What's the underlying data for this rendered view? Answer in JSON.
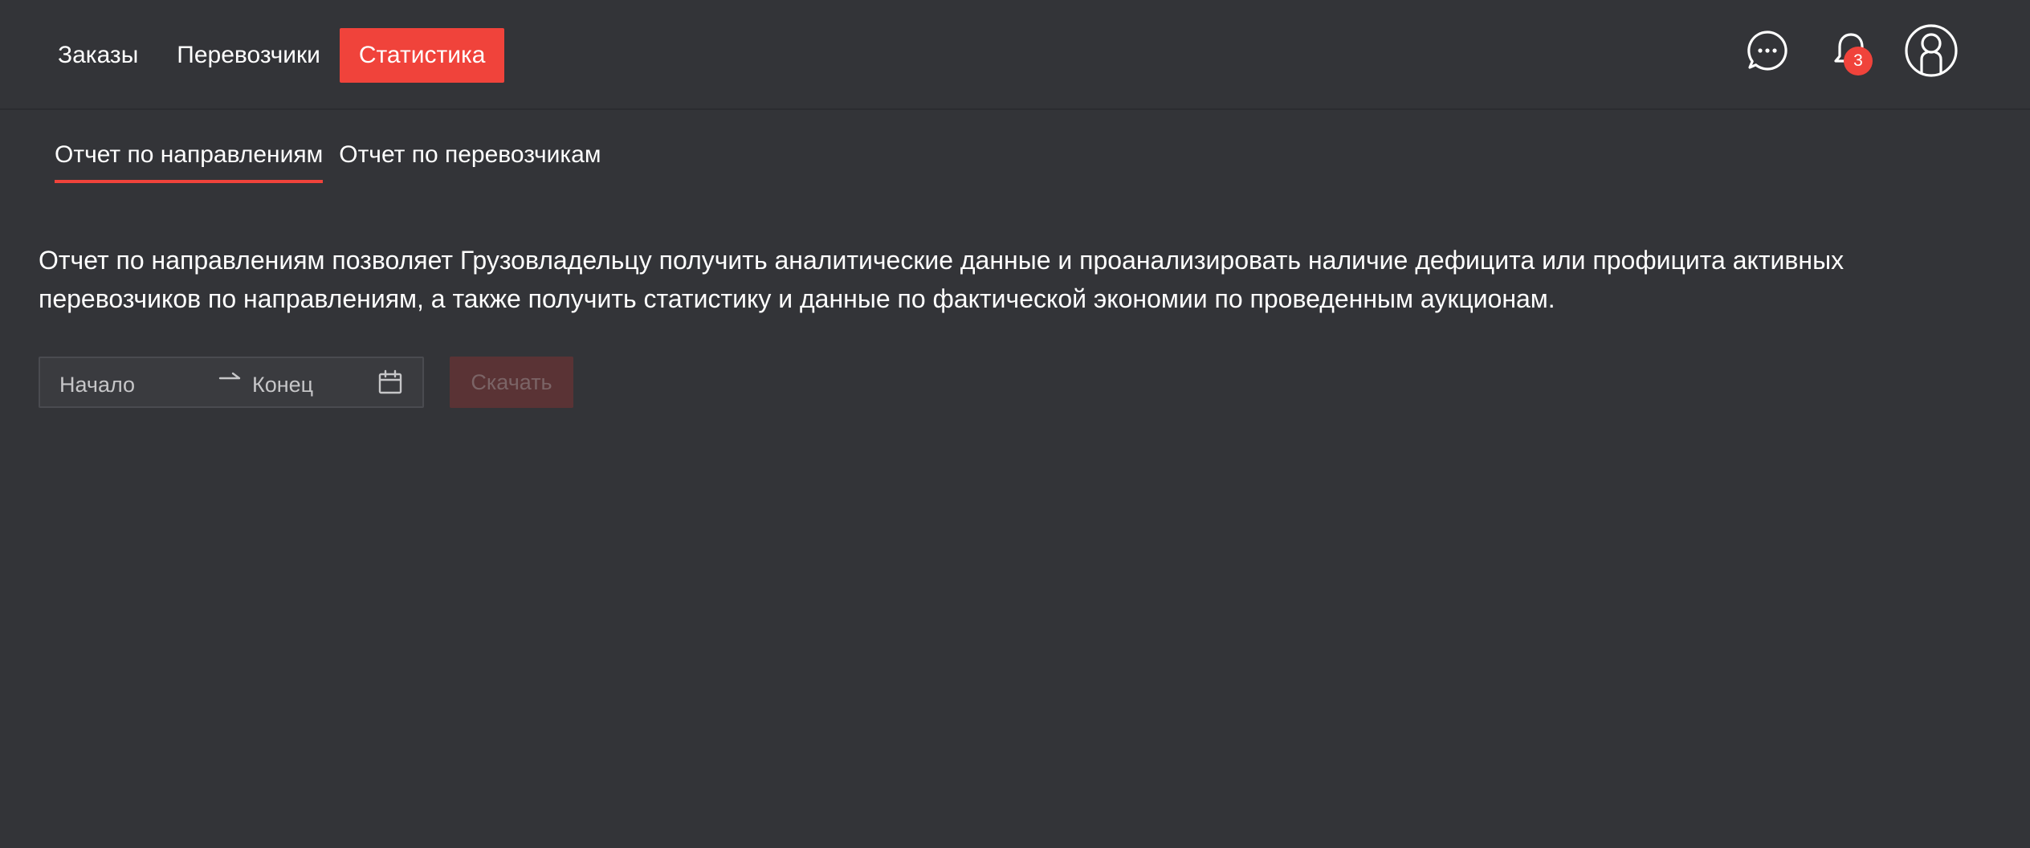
{
  "nav": {
    "items": [
      {
        "label": "Заказы"
      },
      {
        "label": "Перевозчики"
      },
      {
        "label": "Статистика"
      }
    ]
  },
  "header": {
    "chat_icon": "chat-bubble-icon",
    "bell_icon": "bell-icon",
    "notification_count": "3",
    "user_icon": "user-icon"
  },
  "tabs": [
    {
      "label": "Отчет по направлениям"
    },
    {
      "label": "Отчет по перевозчикам"
    }
  ],
  "description": "Отчет по направлениям позволяет Грузовладельцу получить аналитические данные и проанализировать наличие дефицита или профицита активных перевозчиков по направлениям, а также получить статистику и данные по фактической экономии по проведенным аукционам.",
  "date_range": {
    "start_placeholder": "Начало",
    "separator": "→",
    "end_placeholder": "Конец",
    "calendar_icon": "calendar-icon"
  },
  "download_button": {
    "label": "Скачать"
  },
  "colors": {
    "background": "#333438",
    "accent": "#f0433b"
  }
}
